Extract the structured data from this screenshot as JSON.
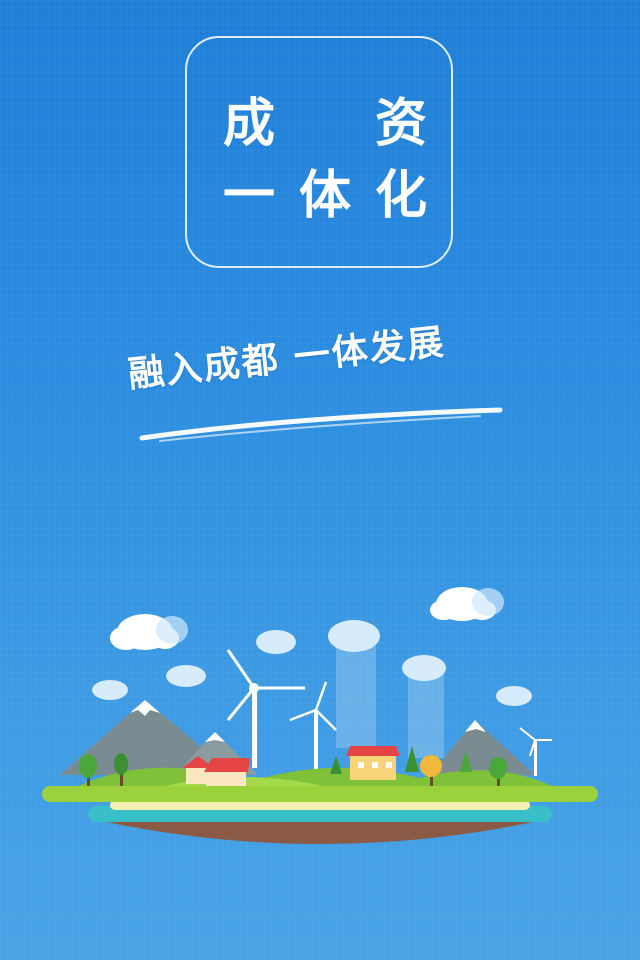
{
  "logo": {
    "line1": [
      "成",
      "资"
    ],
    "line2": [
      "一",
      "体",
      "化"
    ]
  },
  "slogan": {
    "text": "融入成都  一体发展"
  },
  "colors": {
    "background_top": "#1f7fd6",
    "background_bottom": "#4aa3e6",
    "grass": "#9bd13a",
    "water": "#38bfc7",
    "sand": "#f5eeb0",
    "soil": "#8a5a44"
  },
  "illustration": {
    "name": "floating-island-eco-town"
  }
}
